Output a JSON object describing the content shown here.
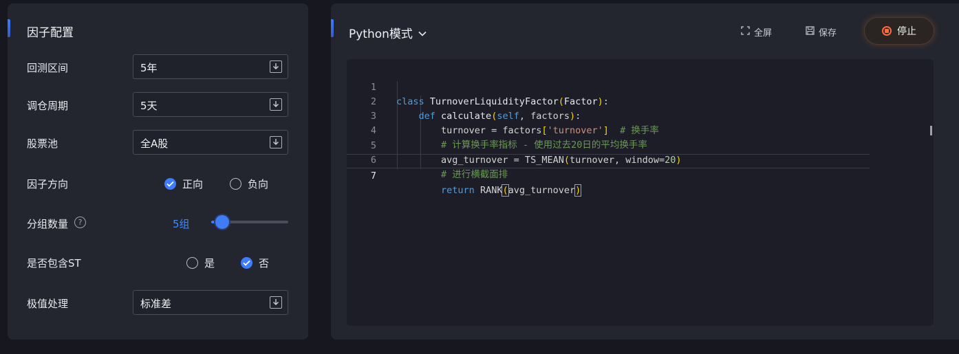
{
  "left_panel": {
    "title": "因子配置",
    "backtest_range": {
      "label": "回测区间",
      "value": "5年"
    },
    "rebalance_period": {
      "label": "调仓周期",
      "value": "5天"
    },
    "stock_pool": {
      "label": "股票池",
      "value": "全A股"
    },
    "factor_direction": {
      "label": "因子方向",
      "options": [
        "正向",
        "负向"
      ],
      "selected": "正向"
    },
    "group_count": {
      "label": "分组数量",
      "value": "5组",
      "help": "?",
      "slider_fraction": 0.08
    },
    "include_st": {
      "label": "是否包含ST",
      "options": [
        "是",
        "否"
      ],
      "selected": "否"
    },
    "outlier": {
      "label": "极值处理",
      "value": "标准差"
    }
  },
  "right_panel": {
    "mode": "Python模式",
    "fullscreen_label": "全屏",
    "save_label": "保存",
    "stop_label": "停止"
  },
  "editor": {
    "current_line": 7,
    "lines": [
      {
        "n": "1",
        "text": "class TurnoverLiquidityFactor(Factor):"
      },
      {
        "n": "2",
        "text": "    def calculate(self, factors):"
      },
      {
        "n": "3",
        "text": "        turnover = factors['turnover']  # 换手率"
      },
      {
        "n": "4",
        "text": "        # 计算换手率指标 - 使用过去20日的平均换手率"
      },
      {
        "n": "5",
        "text": "        avg_turnover = TS_MEAN(turnover, window=20)"
      },
      {
        "n": "6",
        "text": "        # 进行横截面排序"
      },
      {
        "n": "7",
        "text": "        return RANK(avg_turnover)"
      }
    ]
  },
  "colors": {
    "accent": "#3d7bff",
    "background": "#17181f",
    "panel": "#23262f",
    "stop": "#ff6a3d"
  }
}
